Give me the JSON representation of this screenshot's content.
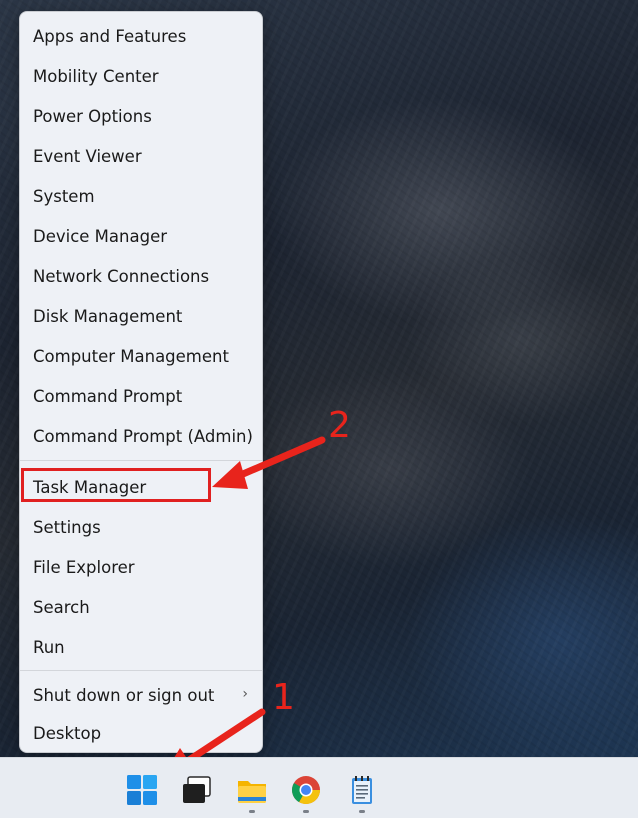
{
  "menu": {
    "items": [
      {
        "label": "Apps and Features"
      },
      {
        "label": "Mobility Center"
      },
      {
        "label": "Power Options"
      },
      {
        "label": "Event Viewer"
      },
      {
        "label": "System"
      },
      {
        "label": "Device Manager"
      },
      {
        "label": "Network Connections"
      },
      {
        "label": "Disk Management"
      },
      {
        "label": "Computer Management"
      },
      {
        "label": "Command Prompt"
      },
      {
        "label": "Command Prompt (Admin)"
      },
      {
        "label": "Task Manager"
      },
      {
        "label": "Settings"
      },
      {
        "label": "File Explorer"
      },
      {
        "label": "Search"
      },
      {
        "label": "Run"
      },
      {
        "label": "Shut down or sign out"
      },
      {
        "label": "Desktop"
      }
    ],
    "submenu_indicator": "›"
  },
  "annotations": {
    "step1": "1",
    "step2": "2",
    "color": "#e8241c"
  },
  "taskbar": {
    "icons": [
      "start-icon",
      "task-view-icon",
      "file-explorer-icon",
      "chrome-icon",
      "notepad-icon"
    ]
  }
}
